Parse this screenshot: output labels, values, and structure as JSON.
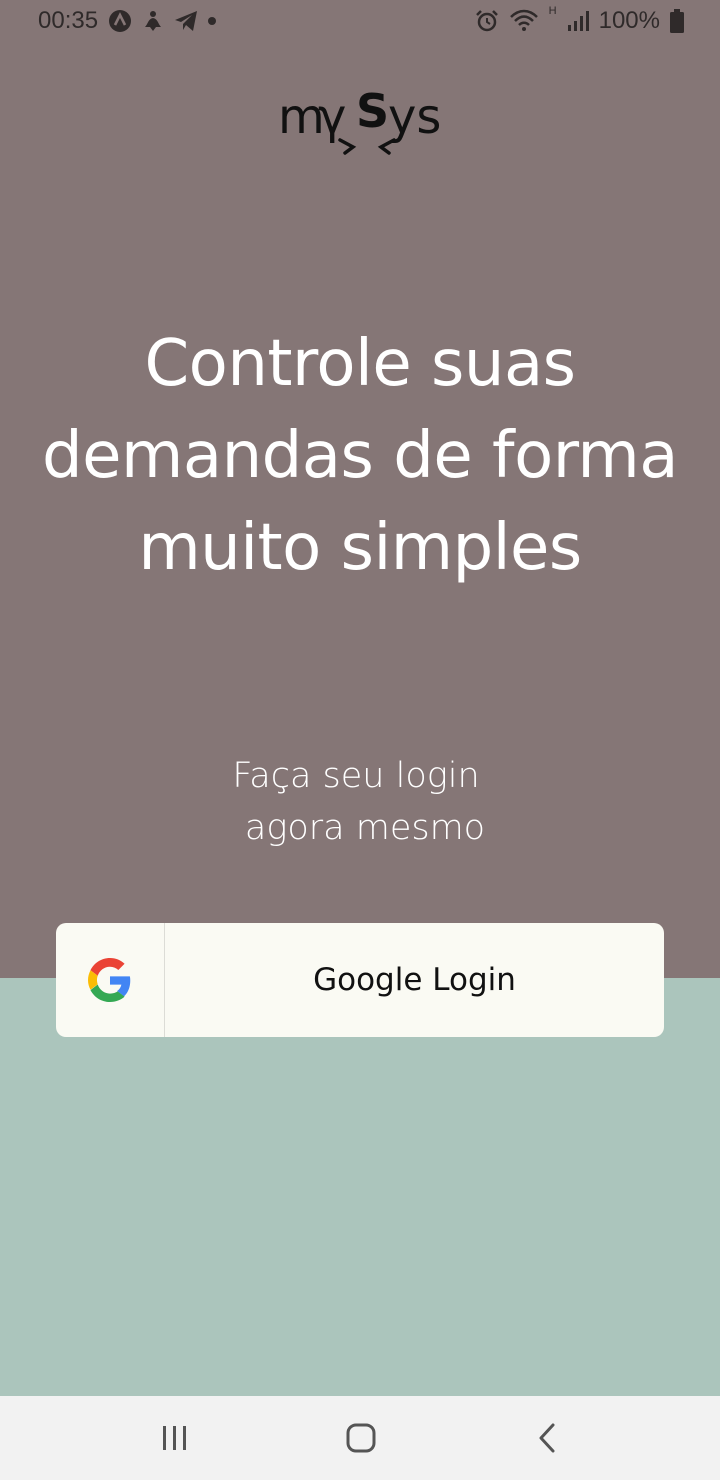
{
  "status_bar": {
    "time": "00:35",
    "battery": "100%",
    "network_badge": "H"
  },
  "logo": {
    "text": "mySys"
  },
  "headline": {
    "line1": "Controle suas",
    "line2": "demandas de forma",
    "line3": "muito simples"
  },
  "subtitle": {
    "line1": "Faça seu login",
    "line2": "agora mesmo"
  },
  "login_button": {
    "label": "Google Login",
    "icon": "google-icon"
  },
  "colors": {
    "top_background": "#857676",
    "bottom_background": "#abc5bc",
    "button_background": "#fafaf3",
    "nav_background": "#f2f2f2"
  }
}
